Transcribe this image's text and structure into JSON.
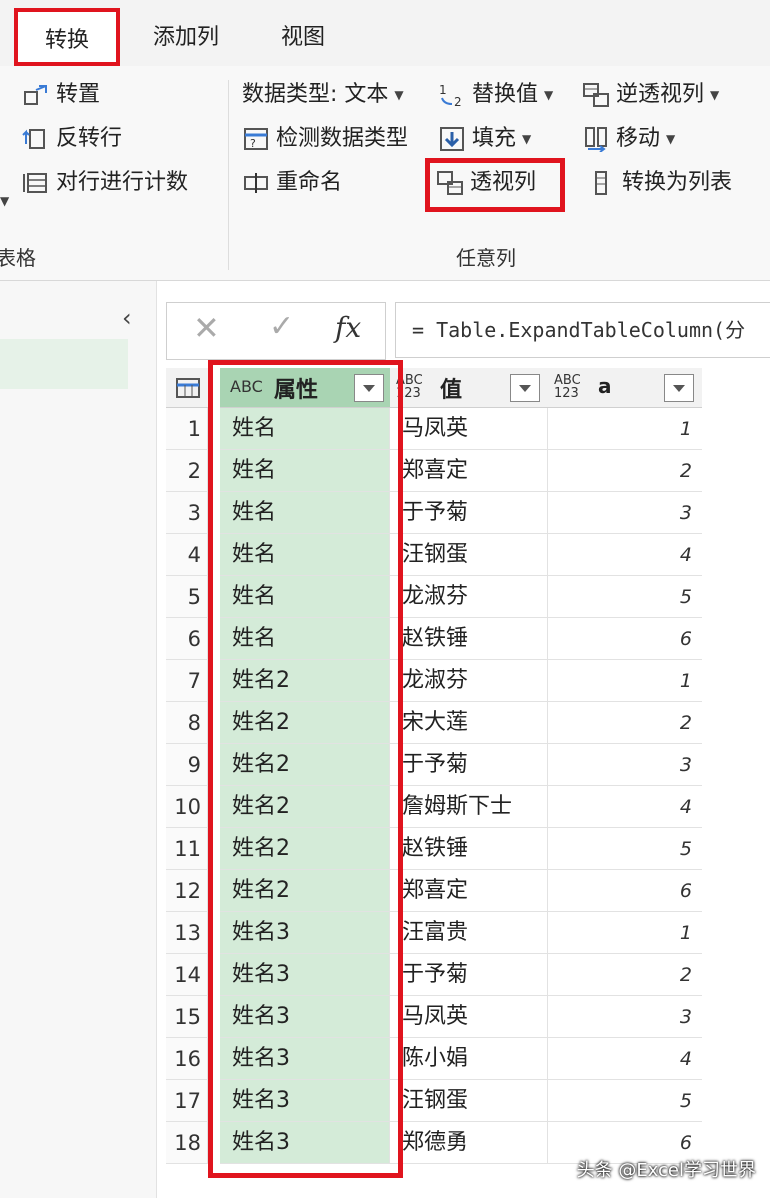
{
  "tabs": [
    "转换",
    "添加列",
    "视图"
  ],
  "ribbon": {
    "table_group": {
      "items": [
        "转置",
        "反转行",
        "对行进行计数"
      ],
      "label": "表格"
    },
    "any_column_group": {
      "data_type": "数据类型: 文本",
      "detect_type": "检测数据类型",
      "rename": "重命名",
      "replace_values": "替换值",
      "fill": "填充",
      "pivot_column": "透视列",
      "unpivot_columns": "逆透视列",
      "move": "移动",
      "convert_to_list": "转换为列表",
      "label": "任意列"
    }
  },
  "formula": {
    "fx": "fx",
    "text": "= Table.ExpandTableColumn(分"
  },
  "columns": {
    "attr": {
      "type": "ABC",
      "name": "属性"
    },
    "value": {
      "type": "ABC 123",
      "name": "值"
    },
    "a": {
      "type": "ABC 123",
      "name": "a"
    }
  },
  "rows": [
    {
      "n": "1",
      "attr": "姓名",
      "val": "马凤英",
      "a": "1"
    },
    {
      "n": "2",
      "attr": "姓名",
      "val": "郑喜定",
      "a": "2"
    },
    {
      "n": "3",
      "attr": "姓名",
      "val": "于予菊",
      "a": "3"
    },
    {
      "n": "4",
      "attr": "姓名",
      "val": "汪钢蛋",
      "a": "4"
    },
    {
      "n": "5",
      "attr": "姓名",
      "val": "龙淑芬",
      "a": "5"
    },
    {
      "n": "6",
      "attr": "姓名",
      "val": "赵铁锤",
      "a": "6"
    },
    {
      "n": "7",
      "attr": "姓名2",
      "val": "龙淑芬",
      "a": "1"
    },
    {
      "n": "8",
      "attr": "姓名2",
      "val": "宋大莲",
      "a": "2"
    },
    {
      "n": "9",
      "attr": "姓名2",
      "val": "于予菊",
      "a": "3"
    },
    {
      "n": "10",
      "attr": "姓名2",
      "val": "詹姆斯下士",
      "a": "4"
    },
    {
      "n": "11",
      "attr": "姓名2",
      "val": "赵铁锤",
      "a": "5"
    },
    {
      "n": "12",
      "attr": "姓名2",
      "val": "郑喜定",
      "a": "6"
    },
    {
      "n": "13",
      "attr": "姓名3",
      "val": "汪富贵",
      "a": "1"
    },
    {
      "n": "14",
      "attr": "姓名3",
      "val": "于予菊",
      "a": "2"
    },
    {
      "n": "15",
      "attr": "姓名3",
      "val": "马凤英",
      "a": "3"
    },
    {
      "n": "16",
      "attr": "姓名3",
      "val": "陈小娟",
      "a": "4"
    },
    {
      "n": "17",
      "attr": "姓名3",
      "val": "汪钢蛋",
      "a": "5"
    },
    {
      "n": "18",
      "attr": "姓名3",
      "val": "郑德勇",
      "a": "6"
    }
  ],
  "watermark": "头条 @Excel学习世界",
  "colors": {
    "highlight_red": "#e0141e",
    "selected_column": "#d4ebd8"
  }
}
